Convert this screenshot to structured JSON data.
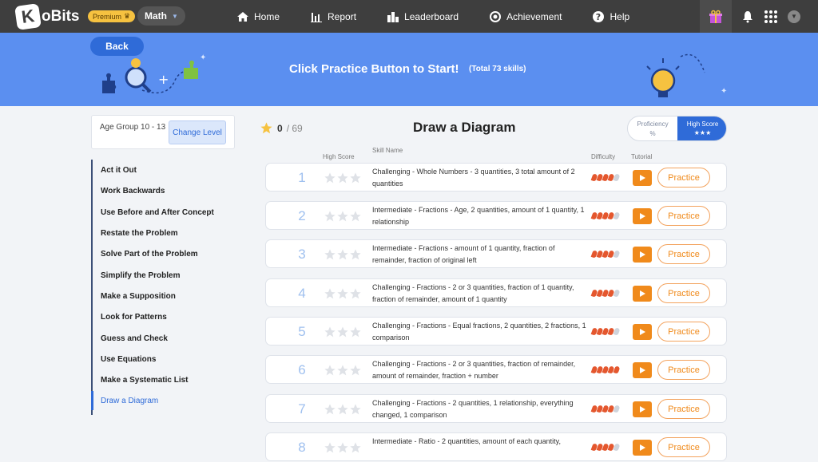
{
  "brand": {
    "logo_text": "oBits",
    "logo_k": "K"
  },
  "premium_label": "Premium",
  "subject": "Math",
  "nav": [
    {
      "label": "Home",
      "icon": "home-icon"
    },
    {
      "label": "Report",
      "icon": "bar-chart-icon"
    },
    {
      "label": "Leaderboard",
      "icon": "leaderboard-icon"
    },
    {
      "label": "Achievement",
      "icon": "medal-icon"
    },
    {
      "label": "Help",
      "icon": "help-icon"
    }
  ],
  "banner": {
    "back_label": "Back",
    "title": "Click Practice Button to Start!",
    "total": "(Total 73 skills)"
  },
  "left": {
    "age_group": "Age Group 10 - 13",
    "change_level": "Change Level",
    "topics": [
      "Act it Out",
      "Work Backwards",
      "Use Before and After Concept",
      "Restate the Problem",
      "Solve Part of the Problem",
      "Simplify the Problem",
      "Make a Supposition",
      "Look for Patterns",
      "Guess and Check",
      "Use Equations",
      "Make a Systematic List",
      "Draw a Diagram"
    ],
    "active_topic": "Draw a Diagram"
  },
  "main": {
    "stars_earned": "0",
    "stars_total": "/ 69",
    "title": "Draw a Diagram",
    "toggle": {
      "proficiency": "Proficiency",
      "proficiency_unit": "%",
      "high_score": "High Score",
      "high_score_stars": "★★★"
    },
    "columns": {
      "high_score": "High Score",
      "skill_name": "Skill Name",
      "difficulty": "Difficulty",
      "tutorial": "Tutorial"
    },
    "practice_label": "Practice",
    "rows": [
      {
        "num": "1",
        "skill": "Challenging - Whole Numbers - 3 quantities, 3 total amount of 2 quantities",
        "difficulty": 4
      },
      {
        "num": "2",
        "skill": "Intermediate - Fractions - Age, 2 quantities, amount of 1 quantity, 1 relationship",
        "difficulty": 4
      },
      {
        "num": "3",
        "skill": "Intermediate - Fractions - amount of 1 quantity, fraction of remainder, fraction of original left",
        "difficulty": 4
      },
      {
        "num": "4",
        "skill": "Challenging - Fractions - 2 or 3 quantities, fraction of 1 quantity, fraction of remainder, amount of 1 quantity",
        "difficulty": 4
      },
      {
        "num": "5",
        "skill": "Challenging - Fractions - Equal fractions, 2 quantities, 2 fractions, 1 comparison",
        "difficulty": 4
      },
      {
        "num": "6",
        "skill": "Challenging - Fractions - 2 or 3 quantities, fraction of remainder, amount of remainder, fraction + number",
        "difficulty": 5
      },
      {
        "num": "7",
        "skill": "Challenging - Fractions - 2 quantities, 1 relationship, everything changed, 1 comparison",
        "difficulty": 4
      },
      {
        "num": "8",
        "skill": "Intermediate - Ratio - 2 quantities, amount of each quantity,",
        "difficulty": 4
      }
    ]
  },
  "colors": {
    "topbar": "#3e3e3e",
    "banner": "#5b8ff0",
    "accent": "#2f6bd8",
    "practice": "#f08a1b"
  }
}
